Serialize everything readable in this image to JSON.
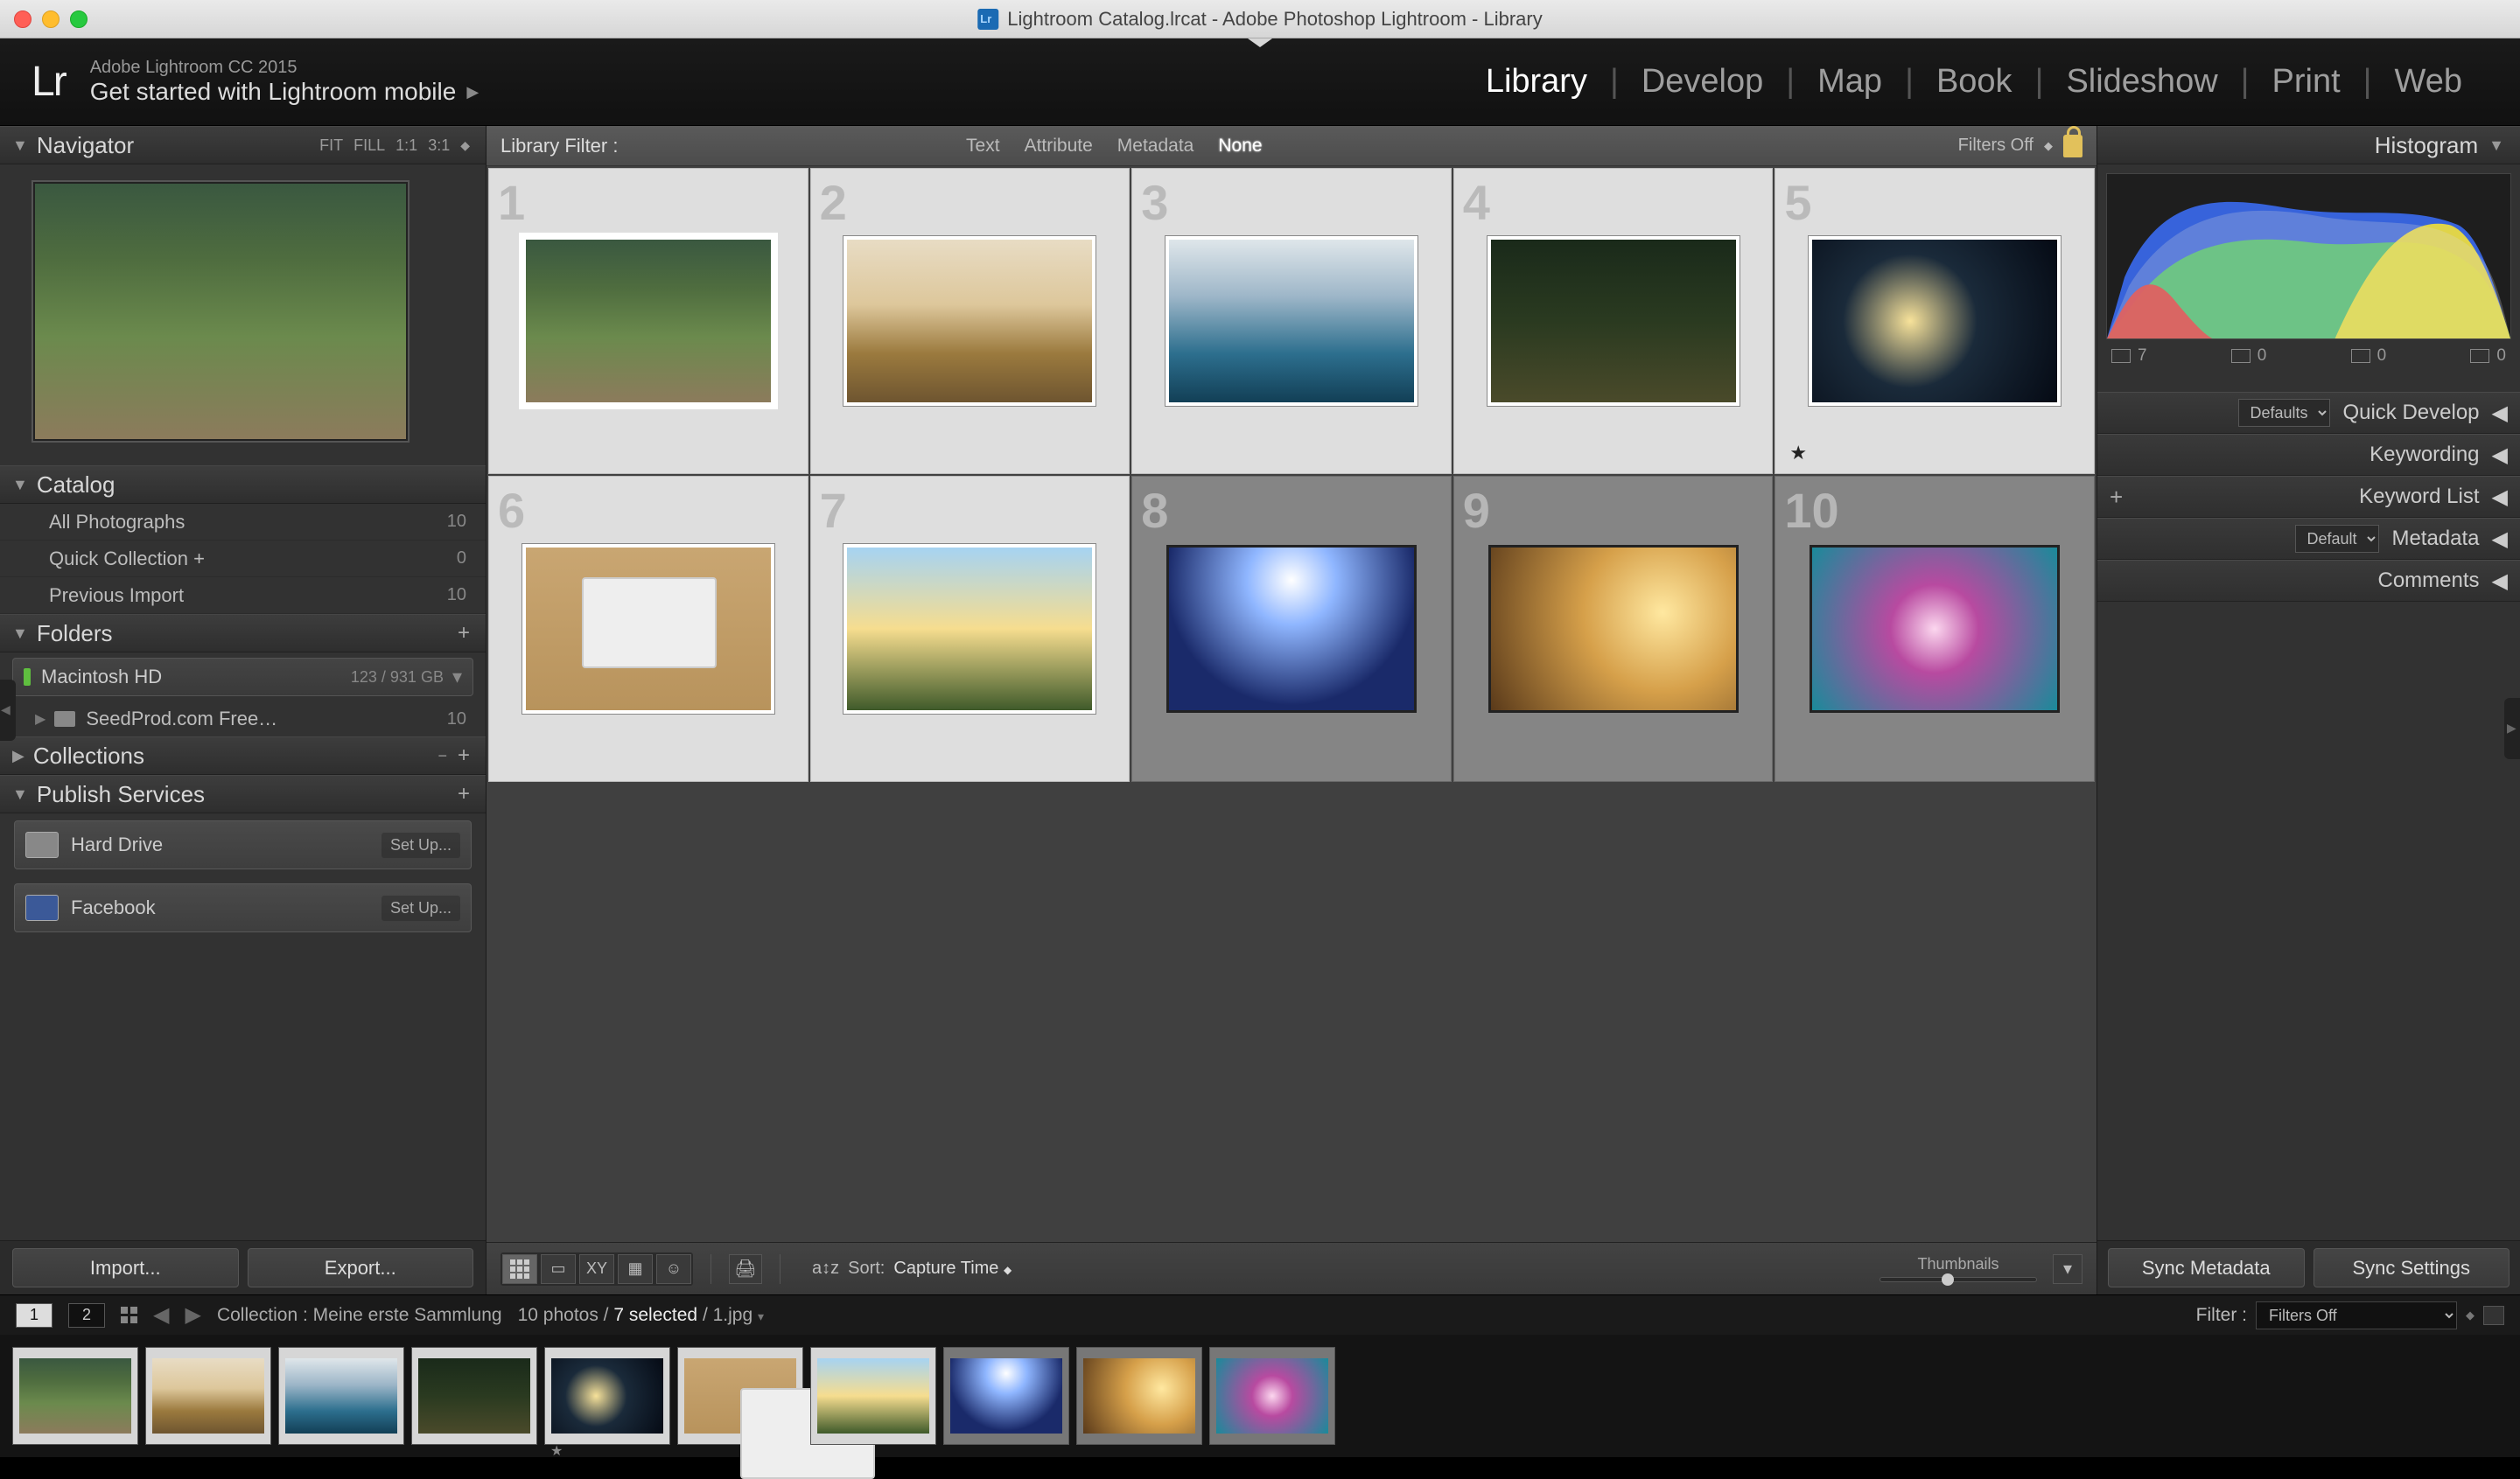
{
  "window_title": "Lightroom Catalog.lrcat - Adobe Photoshop Lightroom - Library",
  "identity": {
    "line1": "Adobe Lightroom CC 2015",
    "line2": "Get started with Lightroom mobile"
  },
  "modules": [
    "Library",
    "Develop",
    "Map",
    "Book",
    "Slideshow",
    "Print",
    "Web"
  ],
  "module_active": "Library",
  "navigator": {
    "title": "Navigator",
    "zoom_opts": [
      "FIT",
      "FILL",
      "1:1",
      "3:1"
    ]
  },
  "catalog": {
    "title": "Catalog",
    "rows": [
      {
        "label": "All Photographs",
        "count": "10"
      },
      {
        "label": "Quick Collection  +",
        "count": "0"
      },
      {
        "label": "Previous Import",
        "count": "10"
      }
    ]
  },
  "folders": {
    "title": "Folders",
    "volume": "Macintosh HD",
    "volume_usage": "123 / 931 GB",
    "items": [
      {
        "label": "SeedProd.com Free…",
        "count": "10"
      }
    ]
  },
  "collections": {
    "title": "Collections"
  },
  "publish": {
    "title": "Publish Services",
    "rows": [
      {
        "label": "Hard Drive",
        "action": "Set Up..."
      },
      {
        "label": "Facebook",
        "action": "Set Up..."
      }
    ]
  },
  "left_buttons": {
    "import": "Import...",
    "export": "Export..."
  },
  "filterbar": {
    "label": "Library Filter :",
    "tabs": [
      "Text",
      "Attribute",
      "Metadata",
      "None"
    ],
    "active": "None",
    "filters_off": "Filters Off"
  },
  "grid": {
    "selected": [
      1,
      2,
      3,
      4,
      5,
      6,
      7
    ],
    "active": 1,
    "star_on": [
      5
    ]
  },
  "toolbar": {
    "sort_label": "Sort:",
    "sort_value": "Capture Time",
    "thumbs_label": "Thumbnails"
  },
  "histogram": {
    "title": "Histogram",
    "crop_count": "7",
    "zeros": [
      "0",
      "0",
      "0"
    ]
  },
  "right_panels": {
    "quick_develop": "Quick Develop",
    "keywording": "Keywording",
    "keyword_list": "Keyword List",
    "metadata": "Metadata",
    "comments": "Comments",
    "defaults": "Defaults",
    "default": "Default"
  },
  "right_buttons": {
    "sync_meta": "Sync Metadata",
    "sync_settings": "Sync Settings"
  },
  "status": {
    "pages": [
      "1",
      "2"
    ],
    "collection_label": "Collection : Meine erste Sammlung",
    "photo_count": "10 photos /",
    "selected": "7 selected",
    "filename": "/ 1.jpg",
    "filter_label": "Filter :",
    "filter_value": "Filters Off"
  }
}
